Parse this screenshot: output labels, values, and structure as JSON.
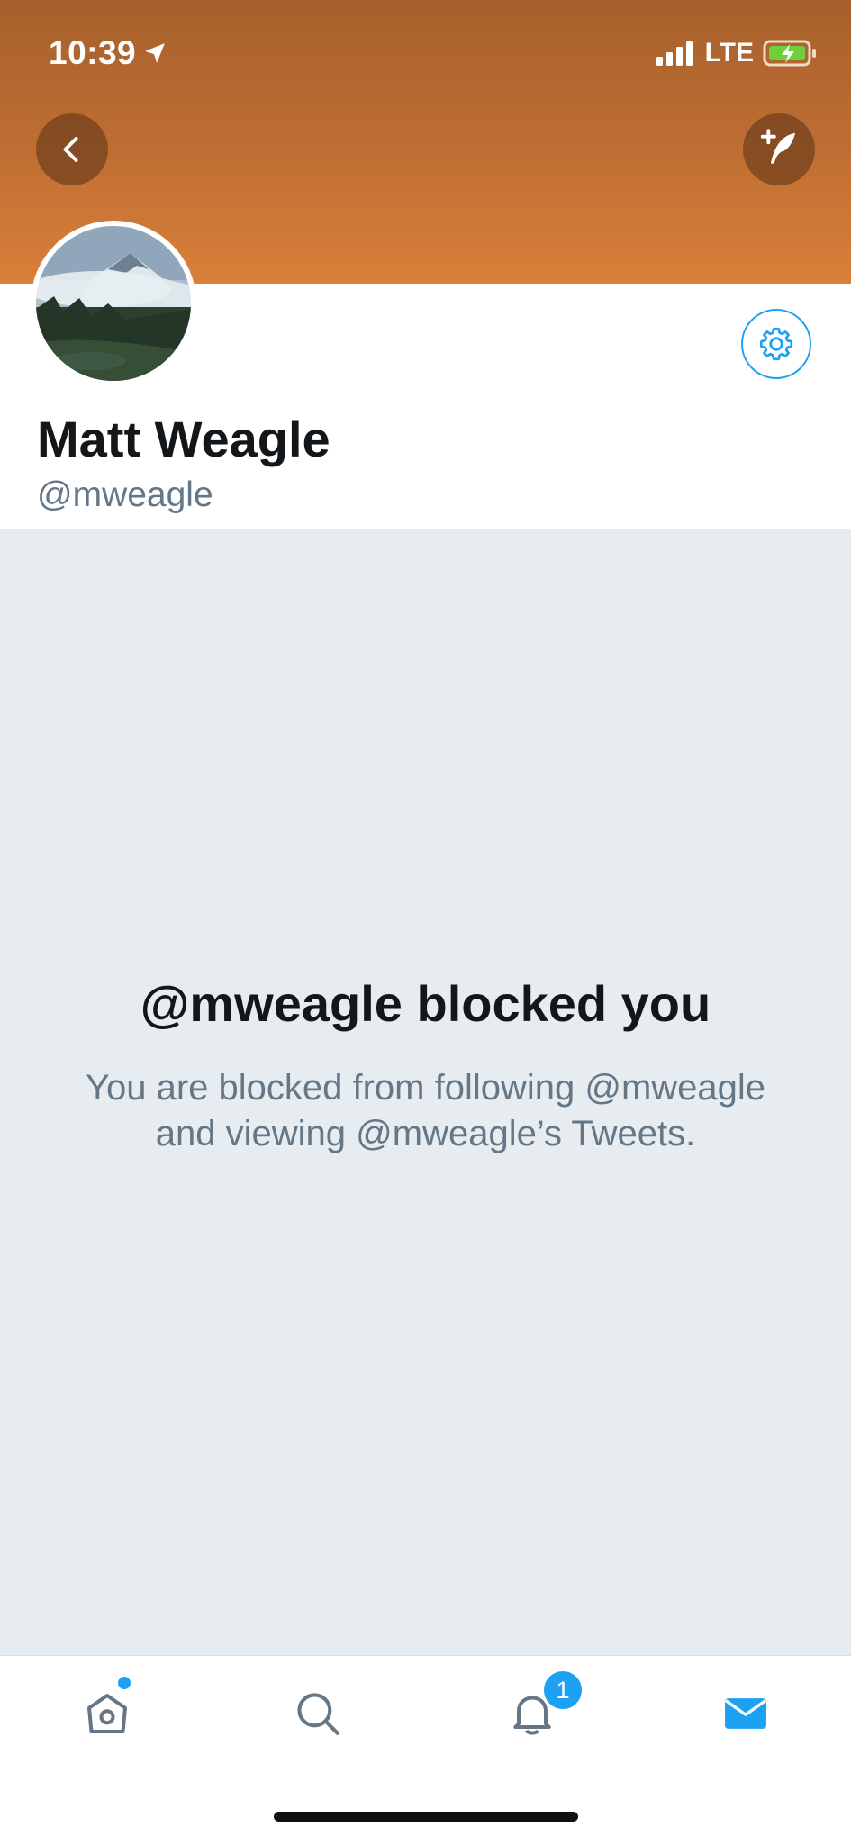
{
  "status_bar": {
    "time": "10:39",
    "network": "LTE"
  },
  "profile": {
    "name": "Matt Weagle",
    "handle": "@mweagle"
  },
  "blocked": {
    "title": "@mweagle blocked you",
    "message": "You are blocked from following @mweagle and viewing @mweagle’s Tweets."
  },
  "tabbar": {
    "notification_count": "1"
  },
  "colors": {
    "banner": "#c06f33",
    "accent": "#1da1f2",
    "background": "#e6ecf0",
    "text": "#14171a",
    "muted": "#657786"
  },
  "icons": [
    "location-arrow-icon",
    "signal-icon",
    "battery-charging-icon",
    "back-icon",
    "compose-tweet-icon",
    "gear-icon",
    "home-icon",
    "search-icon",
    "bell-icon",
    "mail-icon"
  ]
}
